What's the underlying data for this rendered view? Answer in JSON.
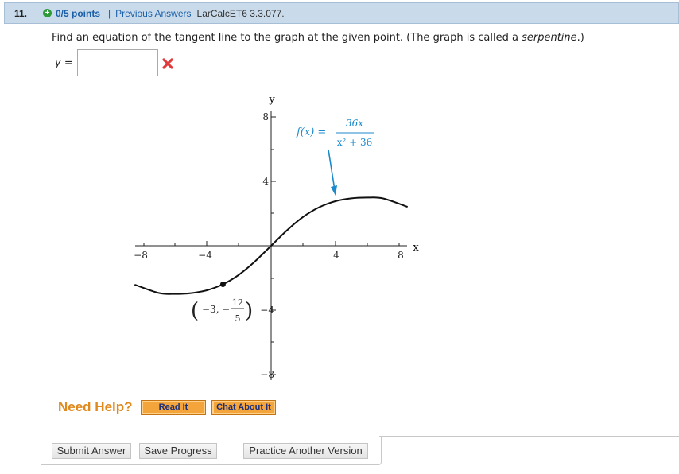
{
  "question": {
    "number": "11.",
    "points": "0/5 points",
    "separator": "|",
    "previous_answers": "Previous Answers",
    "code": "LarCalcET6 3.3.077."
  },
  "prompt": {
    "text": "Find an equation of the tangent line to the graph at the given point. (The graph is called a ",
    "emphasis": "serpentine",
    "end": ".)"
  },
  "answer": {
    "label_var": "y",
    "label_eq": " =",
    "value": "",
    "status": "incorrect"
  },
  "graph": {
    "y_axis_label": "y",
    "x_axis_label": "x",
    "x_ticks": [
      "−8",
      "−4",
      "4",
      "8"
    ],
    "y_ticks": [
      "8",
      "4",
      "−4",
      "−8"
    ],
    "function_label": "f(x) =",
    "numerator": "36x",
    "denominator": "x² + 36",
    "point_label": {
      "open": "(",
      "x": "−3,",
      "minus": "−",
      "num": "12",
      "den": "5",
      "close": ")"
    }
  },
  "chart_data": {
    "type": "line",
    "series": [
      {
        "x": [
          -8.5,
          -7,
          -6,
          -5,
          -4,
          -3,
          -2,
          -1,
          0,
          1,
          2,
          3,
          4,
          5,
          6,
          7,
          8.5
        ],
        "values": [
          -2.42,
          -2.94,
          -3.0,
          -2.95,
          -2.77,
          -2.4,
          -1.8,
          -0.97,
          0,
          0.97,
          1.8,
          2.4,
          2.77,
          2.95,
          3.0,
          2.94,
          2.42
        ]
      }
    ],
    "marked_point": {
      "x": -3,
      "y": -2.4
    },
    "xlim": [
      -8.5,
      8.5
    ],
    "ylim": [
      -8,
      8
    ],
    "grid": false
  },
  "help": {
    "need_help": "Need Help?",
    "read_it": "Read It",
    "chat_about_it": "Chat About It"
  },
  "footer": {
    "submit": "Submit Answer",
    "save": "Save Progress",
    "practice": "Practice Another Version"
  },
  "colors": {
    "header_bg": "#c9dbeb",
    "link": "#1a5fa8",
    "annotation": "#1c8acb",
    "need_help": "#e0891d",
    "error": "#e03b3b"
  }
}
